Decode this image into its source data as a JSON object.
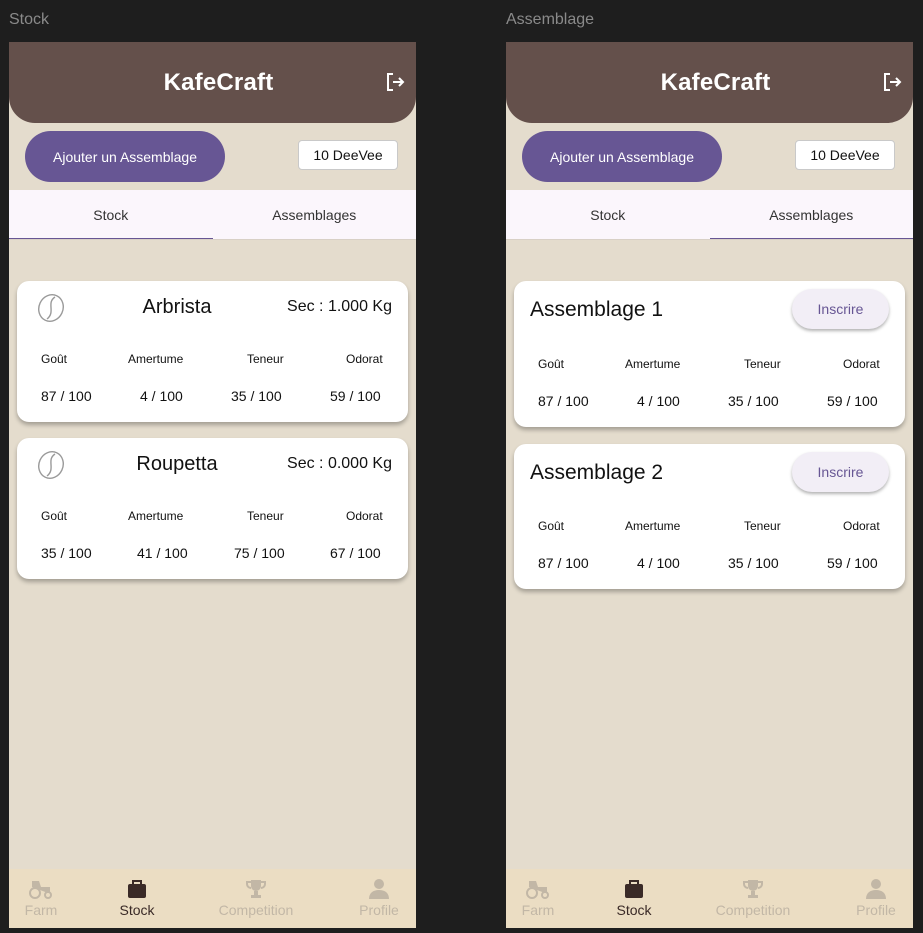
{
  "screens": [
    {
      "frame_label": "Stock",
      "app_title": "KafeCraft",
      "add_button": "Ajouter un Assemblage",
      "balance": "10 DeeVee",
      "tabs": [
        {
          "label": "Stock",
          "active": true
        },
        {
          "label": "Assemblages",
          "active": false
        }
      ],
      "stats_labels": [
        "Goût",
        "Amertume",
        "Teneur",
        "Odorat"
      ],
      "stock_cards": [
        {
          "name": "Arbrista",
          "sec": "Sec : 1.000 Kg",
          "values": [
            "87 / 100",
            "4 / 100",
            "35 / 100",
            "59 / 100"
          ]
        },
        {
          "name": "Roupetta",
          "sec": "Sec : 0.000 Kg",
          "values": [
            "35 / 100",
            "41 / 100",
            "75 / 100",
            "67 / 100"
          ]
        }
      ]
    },
    {
      "frame_label": "Assemblage",
      "app_title": "KafeCraft",
      "add_button": "Ajouter un Assemblage",
      "balance": "10 DeeVee",
      "tabs": [
        {
          "label": "Stock",
          "active": false
        },
        {
          "label": "Assemblages",
          "active": true
        }
      ],
      "stats_labels": [
        "Goût",
        "Amertume",
        "Teneur",
        "Odorat"
      ],
      "blend_cards": [
        {
          "name": "Assemblage 1",
          "button": "Inscrire",
          "values": [
            "87 / 100",
            "4 / 100",
            "35 / 100",
            "59 / 100"
          ]
        },
        {
          "name": "Assemblage 2",
          "button": "Inscrire",
          "values": [
            "87 / 100",
            "4 / 100",
            "35 / 100",
            "59 / 100"
          ]
        }
      ]
    }
  ],
  "bottom_nav": [
    {
      "label": "Farm",
      "icon": "tractor-icon",
      "active": false
    },
    {
      "label": "Stock",
      "icon": "stock-bag-icon",
      "active": true
    },
    {
      "label": "Competition",
      "icon": "trophy-icon",
      "active": false
    },
    {
      "label": "Profile",
      "icon": "person-icon",
      "active": false
    }
  ],
  "colors": {
    "appbar": "#64504b",
    "background": "#e4dccd",
    "primary": "#675694",
    "nav_bg": "#ebddc3",
    "nav_inactive": "#c2b7a6",
    "nav_active": "#3a2a27"
  }
}
